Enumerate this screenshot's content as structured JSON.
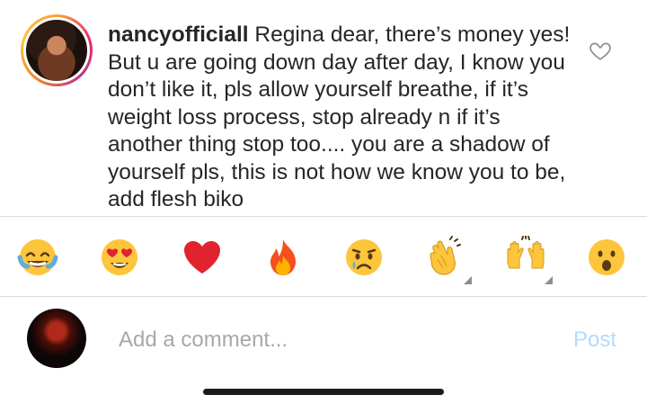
{
  "comment": {
    "username": "nancyofficiall",
    "text": "Regina dear, there’s money yes! But u are going down day after day, I know you don’t like it, pls allow yourself breathe, if it’s weight loss process, stop already n if it’s another thing stop too.... you are a shadow of yourself pls, this is not how we know you to be, add flesh biko"
  },
  "emoji_bar": {
    "items": [
      {
        "name": "tears-of-joy-emoji",
        "glyph": "😂"
      },
      {
        "name": "heart-eyes-emoji",
        "glyph": "😍"
      },
      {
        "name": "red-heart-emoji",
        "glyph": "❤"
      },
      {
        "name": "fire-emoji",
        "glyph": "🔥"
      },
      {
        "name": "crying-face-emoji",
        "glyph": "😢"
      },
      {
        "name": "clapping-hands-emoji",
        "glyph": "👏"
      },
      {
        "name": "raising-hands-emoji",
        "glyph": "🙌"
      },
      {
        "name": "surprised-face-emoji",
        "glyph": "😮"
      }
    ]
  },
  "composer": {
    "placeholder": "Add a comment...",
    "post_label": "Post"
  },
  "colors": {
    "text": "#262626",
    "placeholder": "#a8a8a8",
    "post_disabled": "#b3dbff",
    "divider": "#dbdbdb",
    "heart_red": "#e0232e",
    "emoji_yellow": "#fcc53b"
  }
}
